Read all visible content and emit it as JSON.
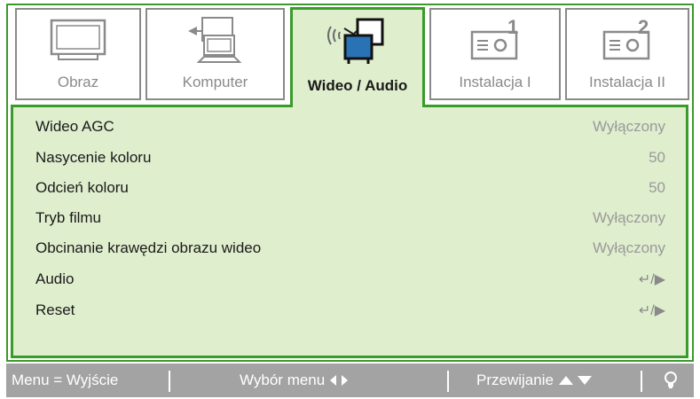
{
  "tabs": [
    {
      "label": "Obraz",
      "icon": "monitor-icon",
      "active": false
    },
    {
      "label": "Komputer",
      "icon": "computer-icon",
      "active": false
    },
    {
      "label": "Wideo / Audio",
      "icon": "video-audio-icon",
      "active": true
    },
    {
      "label": "Instalacja I",
      "icon": "projector-1-icon",
      "active": false
    },
    {
      "label": "Instalacja II",
      "icon": "projector-2-icon",
      "active": false
    }
  ],
  "menu_rows": [
    {
      "label": "Wideo AGC",
      "value": "Wyłączony"
    },
    {
      "label": "Nasycenie koloru",
      "value": "50"
    },
    {
      "label": "Odcień koloru",
      "value": "50"
    },
    {
      "label": "Tryb filmu",
      "value": "Wyłączony"
    },
    {
      "label": "Obcinanie krawędzi obrazu wideo",
      "value": "Wyłączony"
    },
    {
      "label": "Audio",
      "value": "↵/▶"
    },
    {
      "label": "Reset",
      "value": "↵/▶"
    }
  ],
  "status_bar": {
    "exit_hint": "Menu = Wyjście",
    "select_hint": "Wybór menu",
    "scroll_hint": "Przewijanie"
  },
  "colors": {
    "accent": "#3a9a2a",
    "panel_bg": "#dfeecd",
    "status_bg": "#a3a3a3",
    "value_text": "#9a9a9a"
  }
}
